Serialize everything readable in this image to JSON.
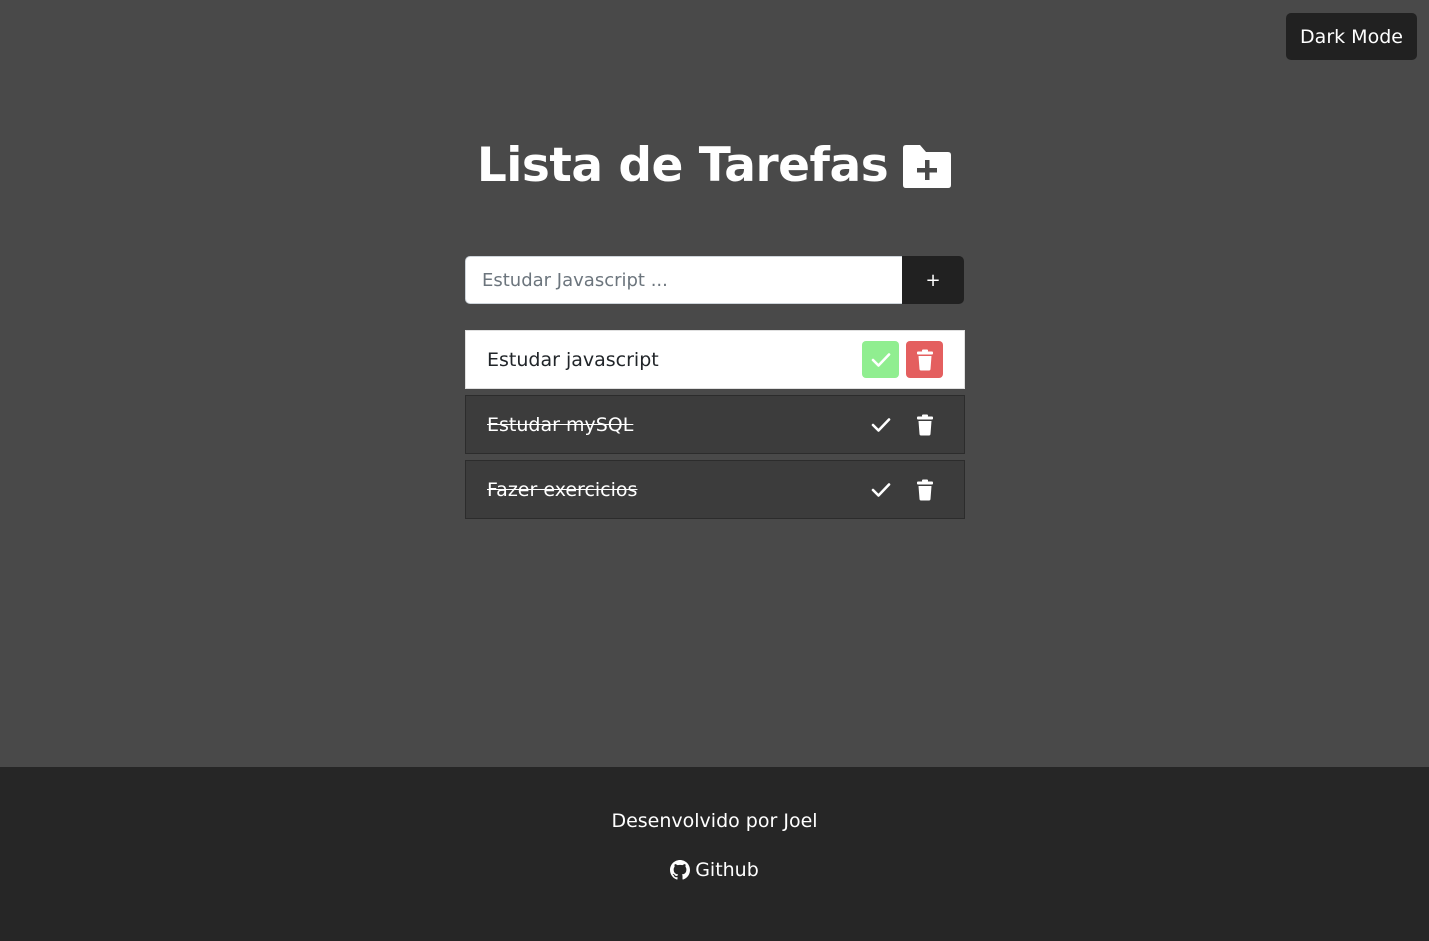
{
  "header": {
    "dark_mode_label": "Dark Mode"
  },
  "main": {
    "title": "Lista de Tarefas",
    "title_icon": "folder-plus-icon",
    "input_placeholder": "Estudar Javascript ...",
    "input_value": "",
    "add_label": "+"
  },
  "todos": [
    {
      "text": "Estudar javascript",
      "done": false
    },
    {
      "text": "Estudar mySQL",
      "done": true
    },
    {
      "text": "Fazer exercicios",
      "done": true
    }
  ],
  "footer": {
    "credit": "Desenvolvido por Joel",
    "github_label": "Github",
    "github_icon": "github-icon"
  },
  "colors": {
    "background": "#494949",
    "footer_bg": "#262626",
    "button_dark": "#212121",
    "check_green": "#90ee90",
    "trash_red": "#e45f5f",
    "done_item_bg": "#3c3c3c"
  }
}
